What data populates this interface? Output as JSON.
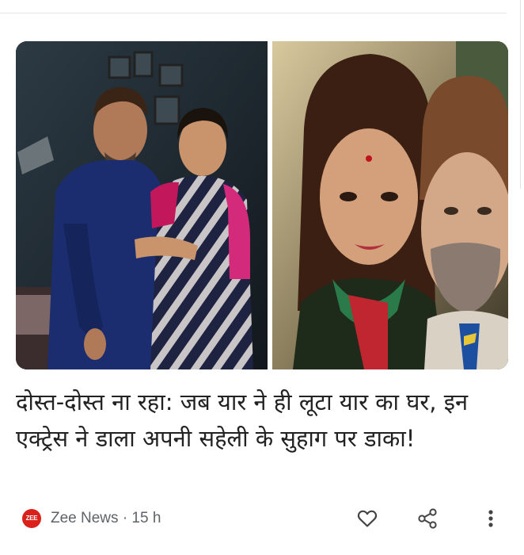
{
  "article": {
    "image_alt": "Two photos side by side: a man in a navy shirt with a woman in a saree, and a close-up selfie of the same pair",
    "headline": "दोस्त-दोस्त ना रहा: जब यार ने ही लूटा यार का घर, इन एक्ट्रेस ने डाला अपनी सहेली के सुहाग पर डाका!",
    "source": {
      "logo_text": "ZEE",
      "name": "Zee News",
      "separator": "·",
      "age": "15 h"
    }
  },
  "actions": {
    "like_icon": "heart-outline-icon",
    "share_icon": "share-icon",
    "more_icon": "more-vert-icon"
  },
  "colors": {
    "headline": "#222222",
    "meta_text": "#5f6368",
    "logo_bg": "#d9201a"
  }
}
